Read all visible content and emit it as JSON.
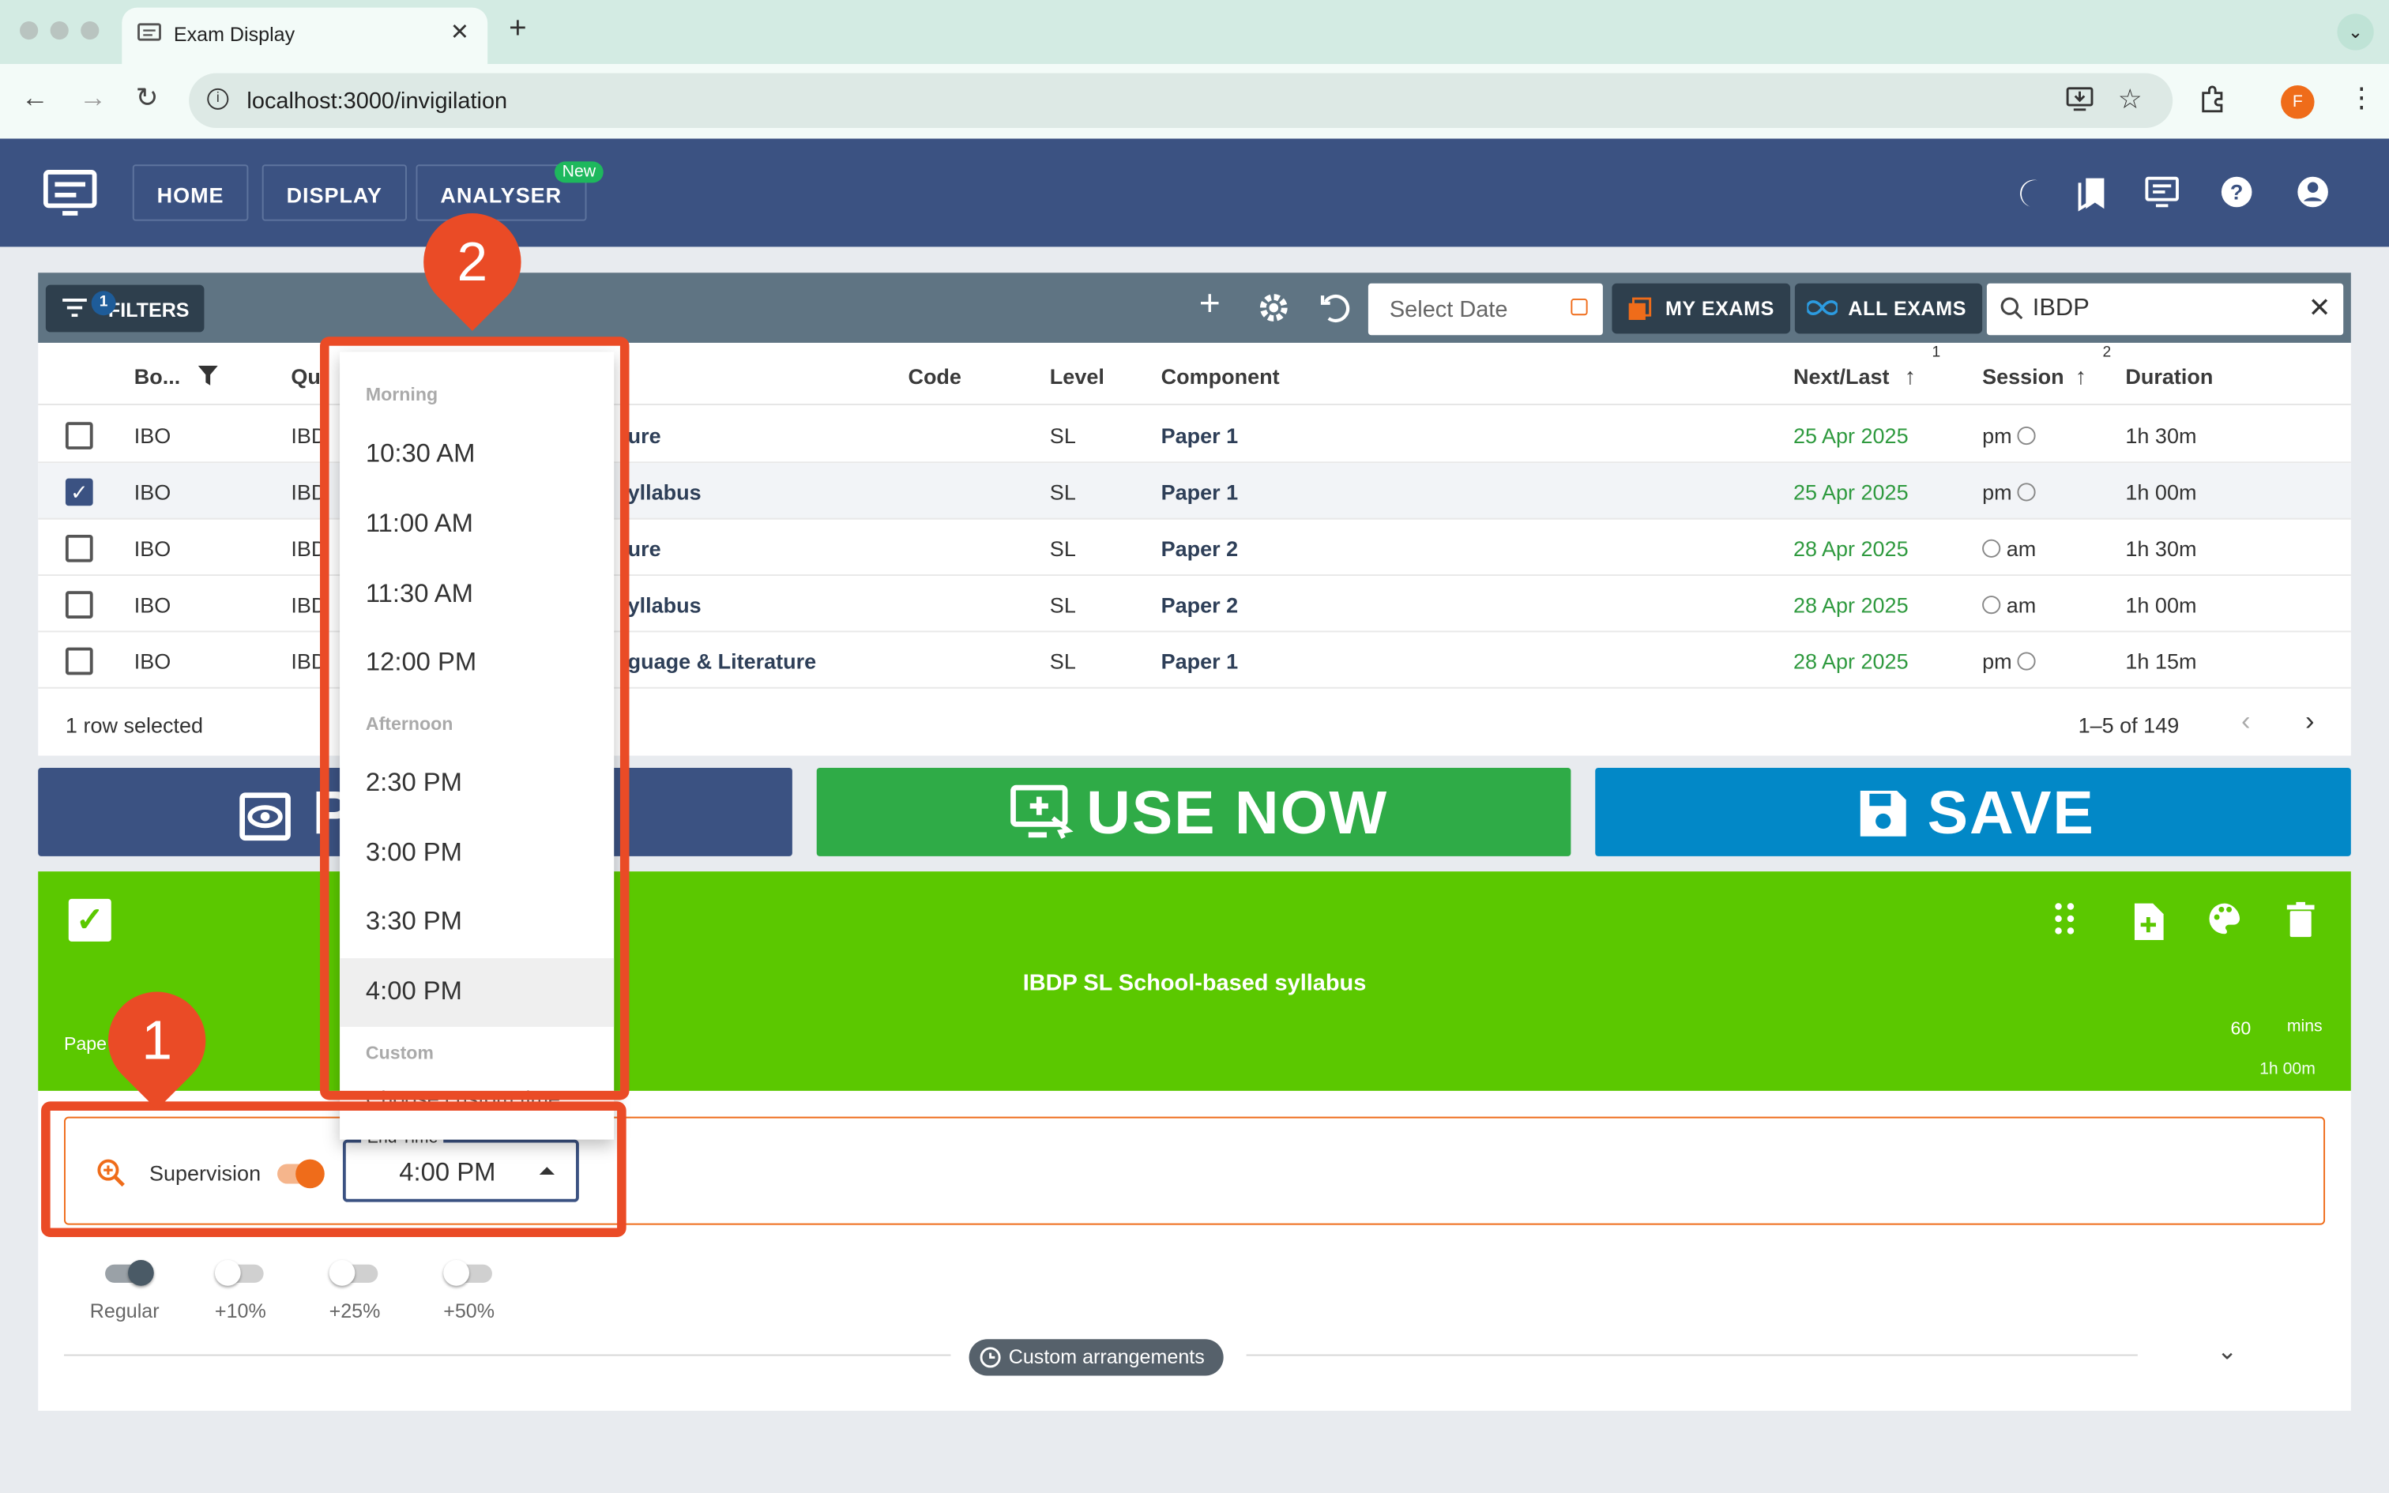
{
  "browser": {
    "tab_title": "Exam Display",
    "tab_close": "✕",
    "new_tab": "+",
    "url": "localhost:3000/invigilation",
    "profile_initial": "F"
  },
  "nav": {
    "home": "HOME",
    "display": "DISPLAY",
    "analyser": "ANALYSER",
    "analyser_badge": "New"
  },
  "toolbar": {
    "filters": "FILTERS",
    "filters_count": "1",
    "date_placeholder": "Select Date",
    "my_exams": "MY EXAMS",
    "all_exams": "ALL EXAMS",
    "search_value": "IBDP"
  },
  "table": {
    "columns": {
      "board": "Bo...",
      "qualification": "Qu",
      "code": "Code",
      "level": "Level",
      "component": "Component",
      "next_last": "Next/Last",
      "next_last_sort": "1",
      "session": "Session",
      "session_sort": "2",
      "duration": "Duration"
    },
    "rows": [
      {
        "board": "IBO",
        "qual": "IBD",
        "title": "ure",
        "level": "SL",
        "component": "Paper 1",
        "date": "25 Apr 2025",
        "session": "pm",
        "duration": "1h 30m",
        "selected": false
      },
      {
        "board": "IBO",
        "qual": "IBD",
        "title": "yllabus",
        "level": "SL",
        "component": "Paper 1",
        "date": "25 Apr 2025",
        "session": "pm",
        "duration": "1h 00m",
        "selected": true
      },
      {
        "board": "IBO",
        "qual": "IBD",
        "title": "ure",
        "level": "SL",
        "component": "Paper 2",
        "date": "28 Apr 2025",
        "session": "am",
        "duration": "1h 30m",
        "selected": false
      },
      {
        "board": "IBO",
        "qual": "IBD",
        "title": "yllabus",
        "level": "SL",
        "component": "Paper 2",
        "date": "28 Apr 2025",
        "session": "am",
        "duration": "1h 00m",
        "selected": false
      },
      {
        "board": "IBO",
        "qual": "IBD",
        "title": "guage & Literature",
        "level": "SL",
        "component": "Paper 1",
        "date": "28 Apr 2025",
        "session": "pm",
        "duration": "1h 15m",
        "selected": false
      }
    ],
    "rows_selected": "1 row selected",
    "pagination": "1–5 of 149"
  },
  "actions": {
    "preview_partial": "P",
    "use_now": "USE NOW",
    "save": "SAVE"
  },
  "panel": {
    "title": "IBDP SL School-based syllabus",
    "paper_partial": "Pape",
    "minutes_value": "60",
    "minutes_unit": "mins",
    "duration": "1h 00m",
    "supervision_label": "Supervision",
    "end_time_label": "End Time",
    "end_time_value": "4:00 PM",
    "extra_time": [
      {
        "label": "Regular",
        "on": true
      },
      {
        "label": "+10%",
        "on": false
      },
      {
        "label": "+25%",
        "on": false
      },
      {
        "label": "+50%",
        "on": false
      }
    ],
    "custom_arrangements": "Custom arrangements"
  },
  "dropdown": {
    "group_morning": "Morning",
    "morning": [
      "10:30 AM",
      "11:00 AM",
      "11:30 AM",
      "12:00 PM"
    ],
    "group_afternoon": "Afternoon",
    "afternoon": [
      "2:30 PM",
      "3:00 PM",
      "3:30 PM",
      "4:00 PM"
    ],
    "group_custom": "Custom",
    "custom_partial": "Choose custom time"
  },
  "callouts": {
    "one": "1",
    "two": "2"
  },
  "colors": {
    "header": "#3b5282",
    "panel_green": "#5bc800",
    "use_now": "#2fab47",
    "save": "#0288c7",
    "callout": "#ea4b26",
    "accent_orange": "#ef6c1a"
  }
}
